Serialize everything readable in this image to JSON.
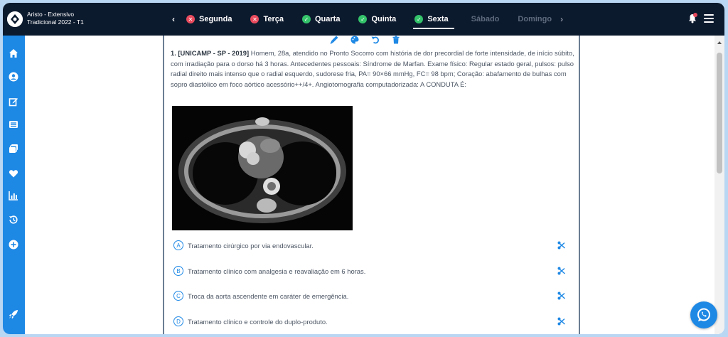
{
  "header": {
    "course_line1": "Aristo - Extensivo",
    "course_line2": "Tradicional 2022 - T1",
    "prev_arrow": "‹",
    "next_arrow": "›",
    "days": [
      {
        "label": "Segunda",
        "status": "error"
      },
      {
        "label": "Terça",
        "status": "error"
      },
      {
        "label": "Quarta",
        "status": "done"
      },
      {
        "label": "Quinta",
        "status": "done"
      },
      {
        "label": "Sexta",
        "status": "done"
      },
      {
        "label": "Sábado",
        "status": "none"
      },
      {
        "label": "Domingo",
        "status": "none"
      }
    ]
  },
  "sidebar": {
    "icons": [
      "home-icon",
      "user-icon",
      "edit-icon",
      "list-icon",
      "cards-icon",
      "heart-icon",
      "chart-icon",
      "history-icon",
      "add-circle-icon",
      "rocket-icon"
    ]
  },
  "question": {
    "ref": "1. [UNICAMP - SP - 2019]",
    "text": "Homem, 28a, atendido no Pronto Socorro com história de dor precordial de forte intensidade, de início súbito, com irradiação para o dorso há 3 horas. Antecedentes pessoais: Síndrome de Marfan. Exame físico: Regular estado geral, pulsos: pulso radial direito mais intenso que o radial esquerdo, sudorese fria, PA= 90×66 mmHg, FC= 98 bpm; Coração: abafamento de bulhas com sopro diastólico em foco aórtico acessório++/4+. Angiotomografia computadorizada: A CONDUTA É:"
  },
  "options": [
    {
      "letter": "A",
      "text": "Tratamento cirúrgico por via endovascular."
    },
    {
      "letter": "B",
      "text": "Tratamento clínico com analgesia e reavaliação em 6 horas."
    },
    {
      "letter": "C",
      "text": "Troca da aorta ascendente em caráter de emergência."
    },
    {
      "letter": "D",
      "text": "Tratamento clínico e controle do duplo-produto."
    }
  ],
  "colors": {
    "header_bg": "#0c1a2e",
    "sidebar_bg": "#1e88e5",
    "accent": "#1e88e5",
    "error": "#e94b5d",
    "success": "#34c36a"
  }
}
